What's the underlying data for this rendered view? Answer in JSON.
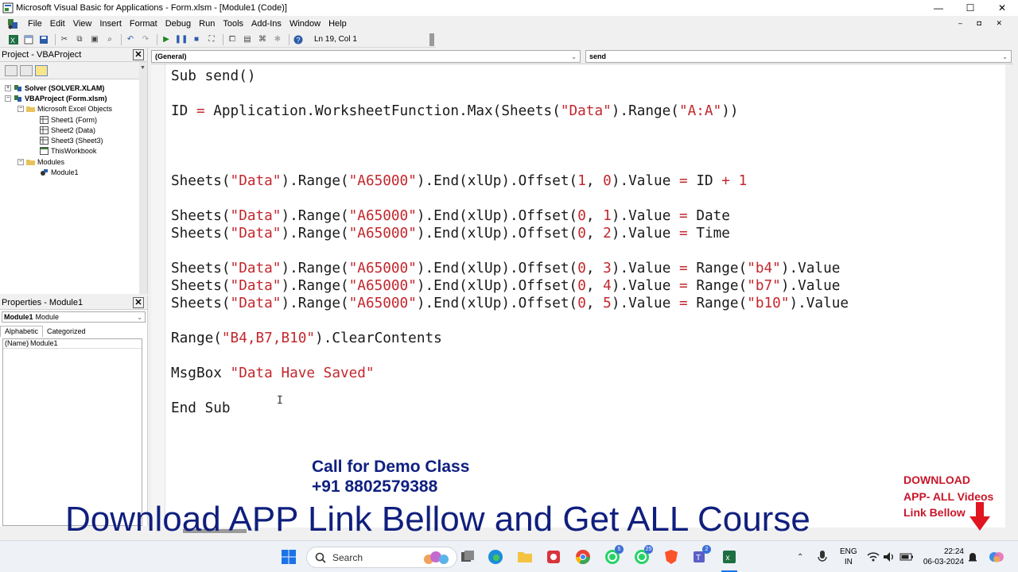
{
  "window": {
    "title": "Microsoft Visual Basic for Applications - Form.xlsm - [Module1 (Code)]",
    "controls": {
      "minimize": "—",
      "maximize": "☐",
      "close": "✕"
    }
  },
  "menu": [
    "File",
    "Edit",
    "View",
    "Insert",
    "Format",
    "Debug",
    "Run",
    "Tools",
    "Add-Ins",
    "Window",
    "Help"
  ],
  "toolbar": {
    "status": "Ln 19, Col 1"
  },
  "project_panel": {
    "title": "Project - VBAProject",
    "tree": [
      {
        "label": "Solver (SOLVER.XLAM)",
        "bold": true,
        "expander": "+"
      },
      {
        "label": "VBAProject (Form.xlsm)",
        "bold": true,
        "expander": "−"
      },
      {
        "label": "Microsoft Excel Objects",
        "bold": false,
        "expander": "−"
      },
      {
        "label": "Sheet1 (Form)",
        "bold": false
      },
      {
        "label": "Sheet2 (Data)",
        "bold": false
      },
      {
        "label": "Sheet3 (Sheet3)",
        "bold": false
      },
      {
        "label": "ThisWorkbook",
        "bold": false
      },
      {
        "label": "Modules",
        "bold": false,
        "expander": "−"
      },
      {
        "label": "Module1",
        "bold": false
      }
    ]
  },
  "properties_panel": {
    "title": "Properties - Module1",
    "object_name": "Module1",
    "object_type": "Module",
    "tabs": [
      "Alphabetic",
      "Categorized"
    ],
    "rows": [
      {
        "key": "(Name)",
        "value": "Module1"
      }
    ]
  },
  "code_window": {
    "object_combo": "(General)",
    "proc_combo": "send",
    "lines": [
      [
        [
          "kw",
          "Sub send()"
        ]
      ],
      [],
      [
        [
          "kw",
          "ID "
        ],
        [
          "op",
          "="
        ],
        [
          "kw",
          " Application.WorksheetFunction.Max(Sheets("
        ],
        [
          "str",
          "\"Data\""
        ],
        [
          "kw",
          ").Range("
        ],
        [
          "str",
          "\"A:A\""
        ],
        [
          "kw",
          "))"
        ]
      ],
      [],
      [],
      [],
      [
        [
          "kw",
          "Sheets("
        ],
        [
          "str",
          "\"Data\""
        ],
        [
          "kw",
          ").Range("
        ],
        [
          "str",
          "\"A65000\""
        ],
        [
          "kw",
          ").End(xlUp).Offset("
        ],
        [
          "num",
          "1"
        ],
        [
          "kw",
          ", "
        ],
        [
          "num",
          "0"
        ],
        [
          "kw",
          ").Value "
        ],
        [
          "op",
          "="
        ],
        [
          "kw",
          " ID "
        ],
        [
          "op",
          "+"
        ],
        [
          "kw",
          " "
        ],
        [
          "num",
          "1"
        ]
      ],
      [],
      [
        [
          "kw",
          "Sheets("
        ],
        [
          "str",
          "\"Data\""
        ],
        [
          "kw",
          ").Range("
        ],
        [
          "str",
          "\"A65000\""
        ],
        [
          "kw",
          ").End(xlUp).Offset("
        ],
        [
          "num",
          "0"
        ],
        [
          "kw",
          ", "
        ],
        [
          "num",
          "1"
        ],
        [
          "kw",
          ").Value "
        ],
        [
          "op",
          "="
        ],
        [
          "kw",
          " Date"
        ]
      ],
      [
        [
          "kw",
          "Sheets("
        ],
        [
          "str",
          "\"Data\""
        ],
        [
          "kw",
          ").Range("
        ],
        [
          "str",
          "\"A65000\""
        ],
        [
          "kw",
          ").End(xlUp).Offset("
        ],
        [
          "num",
          "0"
        ],
        [
          "kw",
          ", "
        ],
        [
          "num",
          "2"
        ],
        [
          "kw",
          ").Value "
        ],
        [
          "op",
          "="
        ],
        [
          "kw",
          " Time"
        ]
      ],
      [],
      [
        [
          "kw",
          "Sheets("
        ],
        [
          "str",
          "\"Data\""
        ],
        [
          "kw",
          ").Range("
        ],
        [
          "str",
          "\"A65000\""
        ],
        [
          "kw",
          ").End(xlUp).Offset("
        ],
        [
          "num",
          "0"
        ],
        [
          "kw",
          ", "
        ],
        [
          "num",
          "3"
        ],
        [
          "kw",
          ").Value "
        ],
        [
          "op",
          "="
        ],
        [
          "kw",
          " Range("
        ],
        [
          "str",
          "\"b4\""
        ],
        [
          "kw",
          ").Value"
        ]
      ],
      [
        [
          "kw",
          "Sheets("
        ],
        [
          "str",
          "\"Data\""
        ],
        [
          "kw",
          ").Range("
        ],
        [
          "str",
          "\"A65000\""
        ],
        [
          "kw",
          ").End(xlUp).Offset("
        ],
        [
          "num",
          "0"
        ],
        [
          "kw",
          ", "
        ],
        [
          "num",
          "4"
        ],
        [
          "kw",
          ").Value "
        ],
        [
          "op",
          "="
        ],
        [
          "kw",
          " Range("
        ],
        [
          "str",
          "\"b7\""
        ],
        [
          "kw",
          ").Value"
        ]
      ],
      [
        [
          "kw",
          "Sheets("
        ],
        [
          "str",
          "\"Data\""
        ],
        [
          "kw",
          ").Range("
        ],
        [
          "str",
          "\"A65000\""
        ],
        [
          "kw",
          ").End(xlUp).Offset("
        ],
        [
          "num",
          "0"
        ],
        [
          "kw",
          ", "
        ],
        [
          "num",
          "5"
        ],
        [
          "kw",
          ").Value "
        ],
        [
          "op",
          "="
        ],
        [
          "kw",
          " Range("
        ],
        [
          "str",
          "\"b10\""
        ],
        [
          "kw",
          ").Value"
        ]
      ],
      [],
      [
        [
          "kw",
          "Range("
        ],
        [
          "str",
          "\"B4,B7,B10\""
        ],
        [
          "kw",
          ").ClearContents"
        ]
      ],
      [],
      [
        [
          "kw",
          "MsgBox "
        ],
        [
          "str",
          "\"Data Have Saved\""
        ]
      ],
      [],
      [
        [
          "kw",
          "End Sub"
        ]
      ]
    ]
  },
  "overlay": {
    "call_line1": "Call for Demo Class",
    "call_line2": "+91 8802579388",
    "banner": "Download APP Link Bellow and Get ALL Course",
    "dl_line1": "DOWNLOAD",
    "dl_line2": "APP- ALL Videos",
    "dl_line3": "Link Bellow"
  },
  "taskbar": {
    "search_label": "Search",
    "lang_line1": "ENG",
    "lang_line2": "IN",
    "time": "22:24",
    "date": "06-03-2024",
    "badges": {
      "whatsapp1": "5",
      "whatsapp2": "25",
      "teams": "2"
    }
  },
  "colors": {
    "code_string": "#c2272d",
    "overlay_blue": "#101f7d",
    "overlay_red": "#c8172a"
  }
}
